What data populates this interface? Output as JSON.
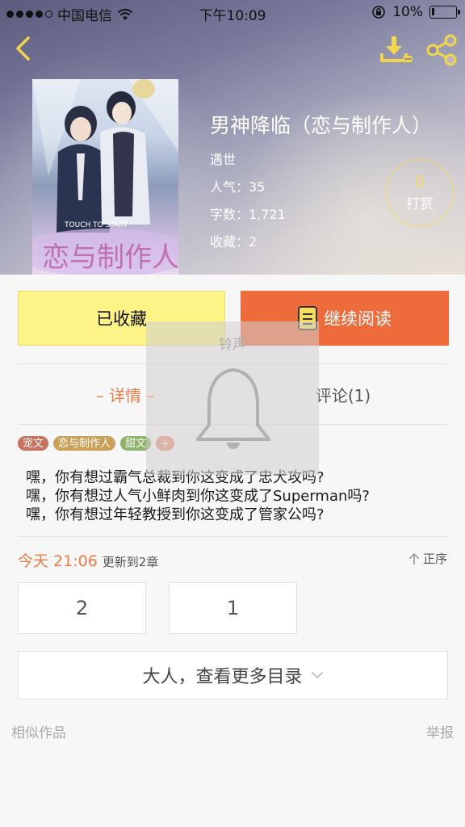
{
  "status_bar": {
    "carrier": "中国电信",
    "time": "下午10:09",
    "battery": "10%"
  },
  "book": {
    "title": "男神降临（恋与制作人）",
    "author": "遇世",
    "popularity": "人气：35",
    "word_count": "字数：1,721",
    "favorites": "收藏：2",
    "cover_title": "恋与制作人",
    "cover_subtitle": "TOUCH TO START"
  },
  "reward": {
    "count": "0",
    "label": "打赏"
  },
  "actions": {
    "favorited_label": "已收藏",
    "continue_label": "继续阅读"
  },
  "tabs": {
    "detail": "– 详情 –",
    "comments": "评论(1)"
  },
  "tags": [
    {
      "label": "宠文",
      "color": "#c9735f"
    },
    {
      "label": "恋与制作人",
      "color": "#caa156"
    },
    {
      "label": "甜文",
      "color": "#8fb36a"
    },
    {
      "label": "+",
      "color": "#e8957a"
    }
  ],
  "synopsis": [
    "嘿，你有想过霸气总裁到你这变成了忠犬攻吗?",
    "嘿，你有想过人气小鲜肉到你这变成了Superman吗?",
    "嘿，你有想过年轻教授到你这变成了管家公吗?"
  ],
  "update": {
    "time": "今天 21:06",
    "text": "更新到2章",
    "order_label": "正序"
  },
  "chapters": [
    "2",
    "1"
  ],
  "more_catalog": "大人，查看更多目录",
  "footer": {
    "similar": "相似作品",
    "report": "举报"
  },
  "ringer_overlay": {
    "label": "铃声"
  },
  "colors": {
    "accent_orange": "#ee6b3c",
    "favorite_yellow": "#fdf488",
    "reward_gold": "#f4d86a"
  }
}
